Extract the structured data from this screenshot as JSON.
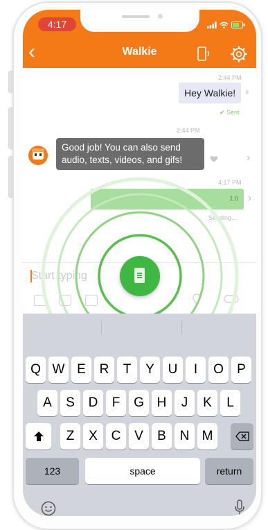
{
  "status_bar": {
    "time": "4:17"
  },
  "nav": {
    "back_label": "‹",
    "title": "Walkie"
  },
  "messages": [
    {
      "timestamp": "2:44 PM",
      "text": "Hey Walkie!",
      "status": "✔ Sent",
      "direction": "out"
    },
    {
      "timestamp": "2:44 PM",
      "text_line1": "Good job! You can also send",
      "text_line2": "audio, texts, videos, and gifs!",
      "direction": "in"
    },
    {
      "timestamp": "4:17 PM",
      "text": "1.0",
      "status": "Sending...",
      "direction": "out",
      "progress": 1.0
    }
  ],
  "composer": {
    "placeholder": "Start typing"
  },
  "keyboard": {
    "row1": [
      "Q",
      "W",
      "E",
      "R",
      "T",
      "Y",
      "U",
      "I",
      "O",
      "P"
    ],
    "row2": [
      "A",
      "S",
      "D",
      "F",
      "G",
      "H",
      "J",
      "K",
      "L"
    ],
    "row3": [
      "Z",
      "X",
      "C",
      "V",
      "B",
      "N",
      "M"
    ],
    "numbers_label": "123",
    "space_label": "space",
    "return_label": "return"
  },
  "colors": {
    "brand_orange": "#f47a17",
    "walkie_green": "#3eb843",
    "time_pill": "#e04636"
  },
  "icons": [
    "back-chevron-icon",
    "walkie-device-icon",
    "settings-gear-icon",
    "heart-icon",
    "image-icon",
    "camera-icon",
    "location-icon",
    "shift-icon",
    "backspace-icon",
    "emoji-icon",
    "microphone-icon"
  ]
}
